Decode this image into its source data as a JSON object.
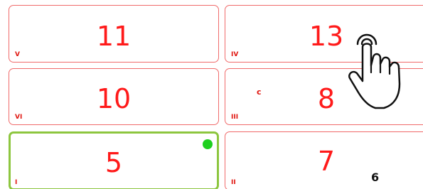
{
  "tiles": [
    {
      "number": "11",
      "roman": "V"
    },
    {
      "number": "13",
      "roman": "IV"
    },
    {
      "number": "10",
      "roman": "VI"
    },
    {
      "number": "8",
      "roman": "III",
      "letter": "c"
    },
    {
      "number": "5",
      "roman": "I",
      "selected": true
    },
    {
      "number": "7",
      "roman": "II",
      "count": "6"
    }
  ],
  "colors": {
    "number": "#ff1a1a",
    "tile_border": "#f06a6a",
    "selected_border": "#8dc63f",
    "status_dot": "#1ed01e"
  },
  "icons": {
    "pointer": "hand-pointer-icon",
    "status": "green-dot-indicator"
  }
}
